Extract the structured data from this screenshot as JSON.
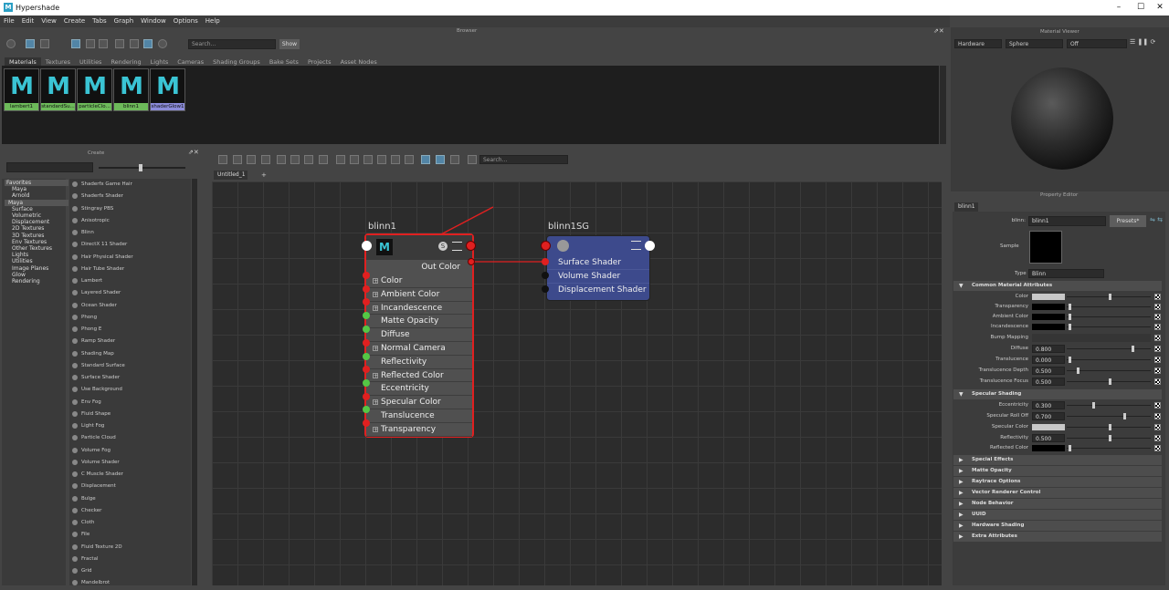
{
  "window": {
    "title": "Hypershade"
  },
  "menu": [
    "File",
    "Edit",
    "View",
    "Create",
    "Tabs",
    "Graph",
    "Window",
    "Options",
    "Help"
  ],
  "browser": {
    "panel_title": "Browser",
    "search_placeholder": "Search...",
    "show_label": "Show",
    "tabs": [
      "Materials",
      "Textures",
      "Utilities",
      "Rendering",
      "Lights",
      "Cameras",
      "Shading Groups",
      "Bake Sets",
      "Projects",
      "Asset Nodes"
    ],
    "materials": [
      "lambert1",
      "standardSu...",
      "particleClo...",
      "blinn1",
      "shaderGlow1"
    ]
  },
  "create": {
    "panel_title": "Create",
    "tree": [
      "Favorites",
      "Maya",
      "Arnold",
      "Maya",
      "Surface",
      "Volumetric",
      "Displacement",
      "2D Textures",
      "3D Textures",
      "Env Textures",
      "Other Textures",
      "Lights",
      "Utilities",
      "Image Planes",
      "Glow",
      "Rendering"
    ],
    "items": [
      "Shaderfx Game Hair",
      "Shaderfx Shader",
      "Stingray PBS",
      "Anisotropic",
      "Blinn",
      "DirectX 11 Shader",
      "Hair Physical Shader",
      "Hair Tube Shader",
      "Lambert",
      "Layered Shader",
      "Ocean Shader",
      "Phong",
      "Phong E",
      "Ramp Shader",
      "Shading Map",
      "Standard Surface",
      "Surface Shader",
      "Use Background",
      "Env Fog",
      "Fluid Shape",
      "Light Fog",
      "Particle Cloud",
      "Volume Fog",
      "Volume Shader",
      "C Muscle Shader",
      "Displacement",
      "Bulge",
      "Checker",
      "Cloth",
      "File",
      "Fluid Texture 2D",
      "Fractal",
      "Grid",
      "Mandelbrot"
    ]
  },
  "graph": {
    "tab": "Untitled_1",
    "tab_add": "+",
    "search_placeholder": "Search...",
    "blinn_node": {
      "name": "blinn1",
      "icon_letter": "M",
      "out_label": "Out Color",
      "rows": [
        "Color",
        "Ambient Color",
        "Incandescence",
        "Matte Opacity",
        "Diffuse",
        "Normal Camera",
        "Reflectivity",
        "Reflected Color",
        "Eccentricity",
        "Specular Color",
        "Translucence",
        "Transparency"
      ]
    },
    "sg_node": {
      "name": "blinn1SG",
      "rows": [
        "Surface Shader",
        "Volume Shader",
        "Displacement Shader"
      ]
    }
  },
  "material_viewer": {
    "panel_title": "Material Viewer",
    "renderer": "Hardware",
    "shape": "Sphere",
    "env": "Off"
  },
  "property_editor": {
    "panel_title": "Property Editor",
    "tab": "blinn1",
    "name_label": "blinn:",
    "name_value": "blinn1",
    "presets_label": "Presets*",
    "sample_label": "Sample",
    "type_label": "Type",
    "type_value": "Blinn",
    "common_section": "Common Material Attributes",
    "common": [
      {
        "label": "Color",
        "value": ""
      },
      {
        "label": "Transparency",
        "value": ""
      },
      {
        "label": "Ambient Color",
        "value": ""
      },
      {
        "label": "Incandescence",
        "value": ""
      },
      {
        "label": "Bump Mapping",
        "value": ""
      },
      {
        "label": "Diffuse",
        "value": "0.800"
      },
      {
        "label": "Translucence",
        "value": "0.000"
      },
      {
        "label": "Translucence Depth",
        "value": "0.500"
      },
      {
        "label": "Translucence Focus",
        "value": "0.500"
      }
    ],
    "specular_section": "Specular Shading",
    "specular": [
      {
        "label": "Eccentricity",
        "value": "0.300"
      },
      {
        "label": "Specular Roll Off",
        "value": "0.700"
      },
      {
        "label": "Specular Color",
        "value": ""
      },
      {
        "label": "Reflectivity",
        "value": "0.500"
      },
      {
        "label": "Reflected Color",
        "value": ""
      }
    ],
    "collapsed": [
      "Special Effects",
      "Matte Opacity",
      "Raytrace Options",
      "Vector Renderer Control",
      "Node Behavior",
      "UUID",
      "Hardware Shading",
      "Extra Attributes"
    ]
  },
  "colors": {
    "accent": "#5285a6",
    "blinn_border": "#e02020",
    "sg_fill": "#3d4a8c",
    "connection": "#e02020"
  }
}
